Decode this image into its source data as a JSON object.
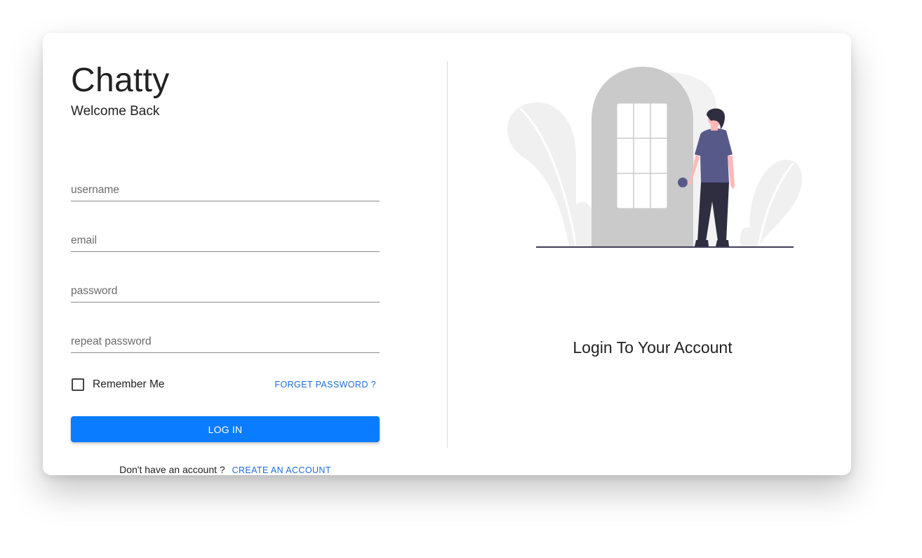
{
  "brand": {
    "title": "Chatty",
    "subtitle": "Welcome Back"
  },
  "form": {
    "username_placeholder": "username",
    "email_placeholder": "email",
    "password_placeholder": "password",
    "repeat_password_placeholder": "repeat password",
    "remember_label": "Remember Me",
    "remember_checked": false,
    "forget_password_label": "FORGET PASSWORD ?",
    "login_label": "LOG IN",
    "signup_prompt": "Don't have an account ?",
    "create_account_label": "CREATE AN ACCOUNT"
  },
  "side_panel": {
    "caption": "Login To Your Account",
    "illustration": "person-at-door-illustration"
  },
  "colors": {
    "primary": "#0a7cff",
    "link": "#1a6fd8",
    "illustration_accent": "#575a89"
  }
}
